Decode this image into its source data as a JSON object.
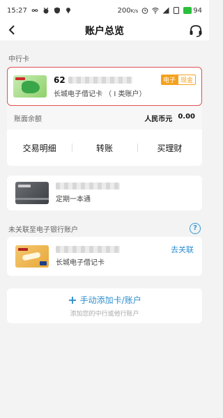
{
  "status_bar": {
    "time": "15:27",
    "speed": "200",
    "speed_unit": "K/s",
    "battery": "94",
    "icons": [
      "infinity-icon",
      "cat-icon",
      "shield-icon",
      "pin-icon",
      "alarm-icon",
      "wifi-icon",
      "signal-icon",
      "sim-icon",
      "battery-icon"
    ]
  },
  "nav": {
    "title": "账户总览",
    "back_icon": "chevron-left-icon",
    "service_icon": "headset-icon"
  },
  "sections": {
    "bank_card_label": "中行卡",
    "unlinked_label": "未关联至电子银行账户"
  },
  "primary_card": {
    "number_prefix": "62",
    "name": "长城电子借记卡 （ I 类账户）",
    "tag_electronic": "电子",
    "tag_cash": "现金",
    "balance_label": "账面余额",
    "currency": "人民币元",
    "balance": "0.00",
    "actions": [
      "交易明细",
      "转账",
      "买理财"
    ]
  },
  "second_account": {
    "name": "定期一本通"
  },
  "unlinked_card": {
    "name": "长城电子借记卡",
    "unlink_label": "去关联"
  },
  "add_card": {
    "title": "手动添加卡/账户",
    "subtitle": "添加您的中行或他行账户"
  },
  "colors": {
    "accent_blue": "#2e8fd0",
    "highlight_red": "#e05050",
    "tag_orange": "#f4a21e",
    "battery_green": "#2bbf3b"
  }
}
